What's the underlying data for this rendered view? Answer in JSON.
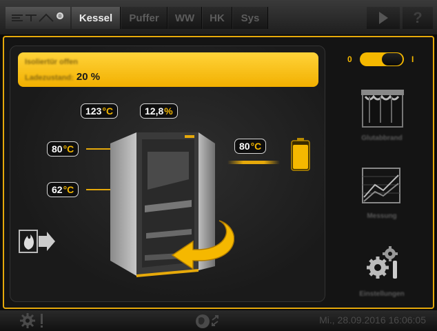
{
  "topbar": {
    "logo_text": "ETA",
    "tabs": [
      {
        "label": "Kessel",
        "active": true
      },
      {
        "label": "Puffer",
        "active": false
      },
      {
        "label": "WW",
        "active": false
      },
      {
        "label": "HK",
        "active": false
      },
      {
        "label": "Sys",
        "active": false
      }
    ],
    "help_label": "?"
  },
  "status": {
    "line1": "Isoliertür offen",
    "line2_label": "Ladezustand:",
    "line2_value": "20 %"
  },
  "toggle": {
    "off_label": "0",
    "on_label": "I",
    "state": "on"
  },
  "readings": {
    "top_temp": {
      "value": "123",
      "unit": "°C"
    },
    "top_pct": {
      "value": "12,8",
      "unit": "%"
    },
    "left_upper": {
      "value": "80",
      "unit": "°C"
    },
    "left_lower": {
      "value": "62",
      "unit": "°C"
    },
    "right": {
      "value": "80",
      "unit": "°C"
    }
  },
  "side_buttons": [
    {
      "icon": "auger-icon",
      "label": "Glutabbrand"
    },
    {
      "icon": "graph-icon",
      "label": "Messung"
    },
    {
      "icon": "gears-icon",
      "label": "Einstellungen"
    }
  ],
  "bottombar": {
    "datetime": "Mi., 28.09.2016 16:06:05"
  },
  "colors": {
    "accent": "#f5b800",
    "frame": "#e6a90a",
    "bg": "#141414"
  }
}
